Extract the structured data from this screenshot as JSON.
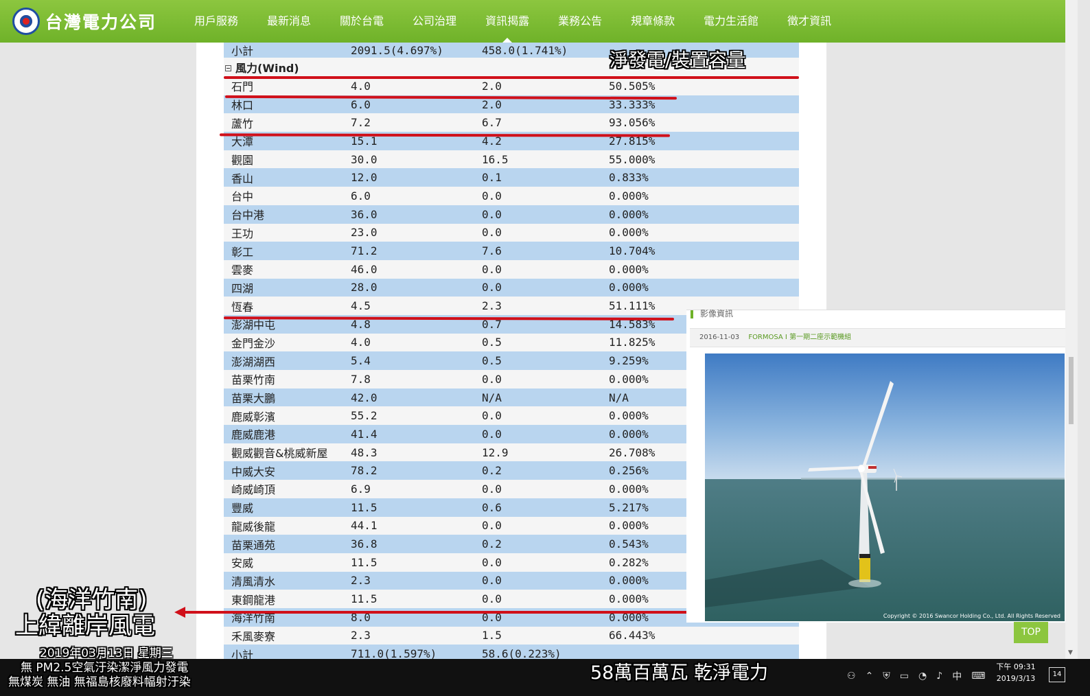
{
  "header": {
    "logo_text": "台灣電力公司",
    "nav": [
      "用戶服務",
      "最新消息",
      "關於台電",
      "公司治理",
      "資訊揭露",
      "業務公告",
      "規章條款",
      "電力生活館",
      "徵才資訊"
    ]
  },
  "table": {
    "top_row": {
      "name": "小計",
      "capacity": "2091.5(4.697%)",
      "net": "458.0(1.741%)",
      "ratio": ""
    },
    "section": "風力(Wind)",
    "rows": [
      {
        "name": "石門",
        "capacity": "4.0",
        "net": "2.0",
        "ratio": "50.505%"
      },
      {
        "name": "林口",
        "capacity": "6.0",
        "net": "2.0",
        "ratio": "33.333%"
      },
      {
        "name": "蘆竹",
        "capacity": "7.2",
        "net": "6.7",
        "ratio": "93.056%"
      },
      {
        "name": "大潭",
        "capacity": "15.1",
        "net": "4.2",
        "ratio": "27.815%"
      },
      {
        "name": "觀園",
        "capacity": "30.0",
        "net": "16.5",
        "ratio": "55.000%"
      },
      {
        "name": "香山",
        "capacity": "12.0",
        "net": "0.1",
        "ratio": "0.833%"
      },
      {
        "name": "台中",
        "capacity": "6.0",
        "net": "0.0",
        "ratio": "0.000%"
      },
      {
        "name": "台中港",
        "capacity": "36.0",
        "net": "0.0",
        "ratio": "0.000%"
      },
      {
        "name": "王功",
        "capacity": "23.0",
        "net": "0.0",
        "ratio": "0.000%"
      },
      {
        "name": "彰工",
        "capacity": "71.2",
        "net": "7.6",
        "ratio": "10.704%"
      },
      {
        "name": "雲麥",
        "capacity": "46.0",
        "net": "0.0",
        "ratio": "0.000%"
      },
      {
        "name": "四湖",
        "capacity": "28.0",
        "net": "0.0",
        "ratio": "0.000%"
      },
      {
        "name": "恆春",
        "capacity": "4.5",
        "net": "2.3",
        "ratio": "51.111%"
      },
      {
        "name": "澎湖中屯",
        "capacity": "4.8",
        "net": "0.7",
        "ratio": "14.583%"
      },
      {
        "name": "金門金沙",
        "capacity": "4.0",
        "net": "0.5",
        "ratio": "11.825%"
      },
      {
        "name": "澎湖湖西",
        "capacity": "5.4",
        "net": "0.5",
        "ratio": "9.259%"
      },
      {
        "name": "苗栗竹南",
        "capacity": "7.8",
        "net": "0.0",
        "ratio": "0.000%"
      },
      {
        "name": "苗栗大鵬",
        "capacity": "42.0",
        "net": "N/A",
        "ratio": "N/A"
      },
      {
        "name": "鹿威彰濱",
        "capacity": "55.2",
        "net": "0.0",
        "ratio": "0.000%"
      },
      {
        "name": "鹿威鹿港",
        "capacity": "41.4",
        "net": "0.0",
        "ratio": "0.000%"
      },
      {
        "name": "觀威觀音&桃威新屋",
        "capacity": "48.3",
        "net": "12.9",
        "ratio": "26.708%"
      },
      {
        "name": "中威大安",
        "capacity": "78.2",
        "net": "0.2",
        "ratio": "0.256%"
      },
      {
        "name": "崎威崎頂",
        "capacity": "6.9",
        "net": "0.0",
        "ratio": "0.000%"
      },
      {
        "name": "豐威",
        "capacity": "11.5",
        "net": "0.6",
        "ratio": "5.217%"
      },
      {
        "name": "龍威後龍",
        "capacity": "44.1",
        "net": "0.0",
        "ratio": "0.000%"
      },
      {
        "name": "苗栗通苑",
        "capacity": "36.8",
        "net": "0.2",
        "ratio": "0.543%"
      },
      {
        "name": "安威",
        "capacity": "11.5",
        "net": "0.0",
        "ratio": "0.282%"
      },
      {
        "name": "清風清水",
        "capacity": "2.3",
        "net": "0.0",
        "ratio": "0.000%"
      },
      {
        "name": "東鋼龍港",
        "capacity": "11.5",
        "net": "0.0",
        "ratio": "0.000%"
      },
      {
        "name": "海洋竹南",
        "capacity": "8.0",
        "net": "0.0",
        "ratio": "0.000%"
      },
      {
        "name": "禾風麥寮",
        "capacity": "2.3",
        "net": "1.5",
        "ratio": "66.443%"
      },
      {
        "name": "小計",
        "capacity": "711.0(1.597%)",
        "net": "58.6(0.223%)",
        "ratio": ""
      }
    ]
  },
  "panel": {
    "title": "影像資訊",
    "date": "2016-11-03",
    "link": "FORMOSA I 第一期二座示範機組",
    "copyright": "Copyright © 2016 Swancor Holding Co., Ltd. All Rights Reserved"
  },
  "top_button": "TOP",
  "overlays": {
    "net_label": "淨發電/裝置容量",
    "offshore_line1": "(海洋竹南)",
    "offshore_line2": "上緯離岸風電",
    "date_line": "2019年03月13日 星期三",
    "caption_line1": "無 PM2.5空氣汙染潔淨風力發電",
    "caption_line2": "無煤炭 無油 無福島核廢料幅射汙染",
    "bottom_caption": "58萬百萬瓦 乾淨電力"
  },
  "taskbar": {
    "ime": "中",
    "time": "下午 09:31",
    "date": "2019/3/13",
    "notify_count": "14"
  },
  "colors": {
    "brand_green": "#8cc63f",
    "row_blue": "#b9d5ef",
    "annotation_red": "#d0101a"
  }
}
